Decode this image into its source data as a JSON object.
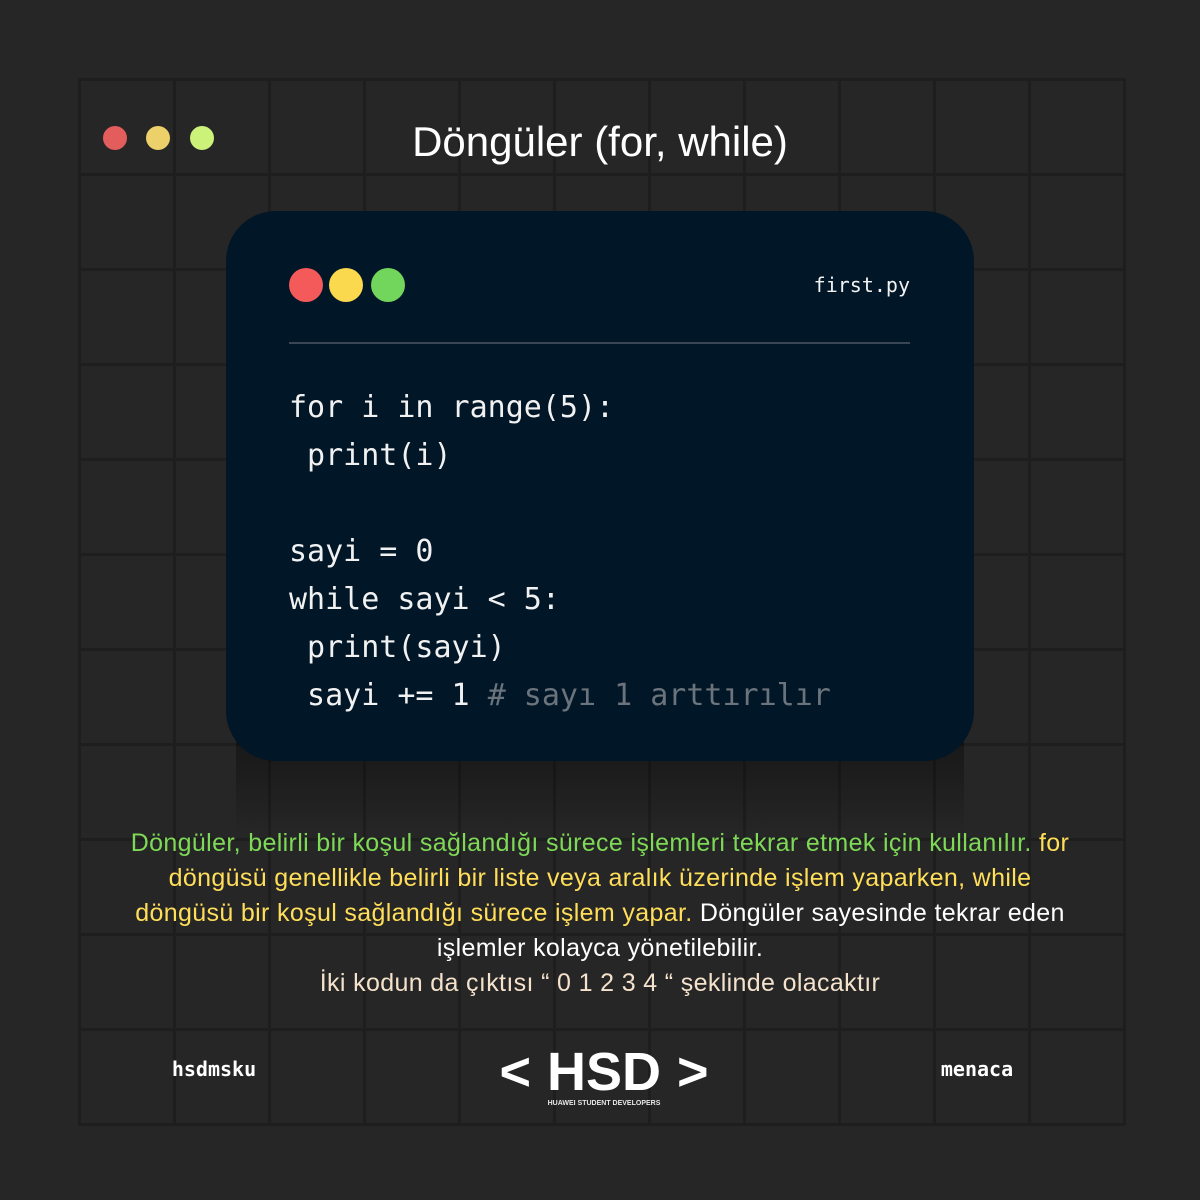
{
  "header": {
    "title": "Döngüler (for, while)",
    "dot_colors": [
      "#e45d5d",
      "#ecd06a",
      "#cdf27a"
    ]
  },
  "code_window": {
    "filename": "first.py",
    "dot_colors": [
      "#f55a5a",
      "#fbd94e",
      "#71d65b"
    ],
    "background": "#011627",
    "lines": [
      "for i in range(5):",
      " print(i)",
      "",
      "sayi = 0",
      "while sayi < 5:",
      " print(sayi)",
      " sayi += 1 "
    ],
    "comment": "# sayı 1 arttırılır",
    "comment_color": "#6b737c"
  },
  "description": {
    "lines": [
      [
        {
          "text": "Döngüler, belirli bir koşul sağlandığı sürece işlemleri tekrar etmek için kullanılır.",
          "color": "#7ed957"
        },
        {
          "text": " for",
          "color": "#ffde59"
        }
      ],
      [
        {
          "text": "döngüsü genellikle belirli bir liste veya aralık üzerinde işlem yaparken, while",
          "color": "#ffde59"
        }
      ],
      [
        {
          "text": "döngüsü bir koşul sağlandığı sürece işlem yapar.",
          "color": "#ffde59"
        },
        {
          "text": " Döngüler sayesinde tekrar eden",
          "color": "#ffffff"
        }
      ],
      [
        {
          "text": "işlemler kolayca yönetilebilir.",
          "color": "#ffffff"
        }
      ],
      [
        {
          "text": "İki kodun da çıktısı “ 0 1 2 3 4 “ şeklinde olacaktır",
          "color": "#f5e2cc"
        }
      ]
    ]
  },
  "footer": {
    "left_handle": "hsdmsku",
    "right_handle": "menaca",
    "logo": {
      "left_bracket": "<",
      "name": "HSD",
      "right_bracket": ">",
      "tagline": "HUAWEI STUDENT DEVELOPERS"
    }
  }
}
